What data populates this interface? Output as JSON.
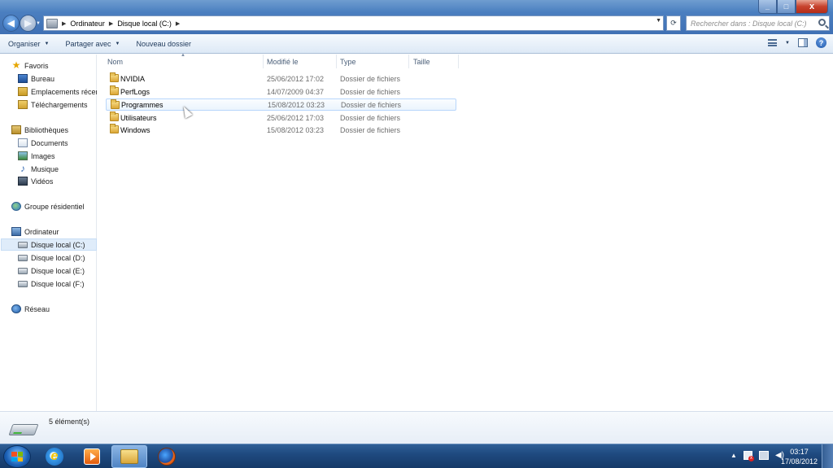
{
  "window": {
    "minimize": "_",
    "maximize": "□",
    "close": "x"
  },
  "address": {
    "crumbs": [
      "Ordinateur",
      "Disque local (C:)"
    ]
  },
  "search": {
    "placeholder": "Rechercher dans : Disque local (C:)"
  },
  "toolbar": {
    "organize": "Organiser",
    "share": "Partager avec",
    "new_folder": "Nouveau dossier",
    "help": "?"
  },
  "sidebar": {
    "favorites_header": "Favoris",
    "favorites": [
      "Bureau",
      "Emplacements récents",
      "Téléchargements"
    ],
    "libraries_header": "Bibliothèques",
    "libraries": [
      "Documents",
      "Images",
      "Musique",
      "Vidéos"
    ],
    "homegroup": "Groupe résidentiel",
    "computer_header": "Ordinateur",
    "drives": [
      "Disque local (C:)",
      "Disque local  (D:)",
      "Disque local  (E:)",
      "Disque local (F:)"
    ],
    "network": "Réseau",
    "selected": "Disque local (C:)"
  },
  "columns": {
    "name": "Nom",
    "modified": "Modifié le",
    "type": "Type",
    "size": "Taille"
  },
  "files": [
    {
      "name": "NVIDIA",
      "modified": "25/06/2012 17:02",
      "type": "Dossier de fichiers"
    },
    {
      "name": "PerfLogs",
      "modified": "14/07/2009 04:37",
      "type": "Dossier de fichiers"
    },
    {
      "name": "Programmes",
      "modified": "15/08/2012 03:23",
      "type": "Dossier de fichiers"
    },
    {
      "name": "Utilisateurs",
      "modified": "25/06/2012 17:03",
      "type": "Dossier de fichiers"
    },
    {
      "name": "Windows",
      "modified": "15/08/2012 03:23",
      "type": "Dossier de fichiers"
    }
  ],
  "hovered_file": "Programmes",
  "details": {
    "count": "5 élément(s)"
  },
  "taskbar": {
    "apps": [
      "internet-explorer-icon",
      "media-player-icon",
      "explorer-icon",
      "firefox-icon"
    ],
    "active_app": "explorer-icon",
    "time": "03:17",
    "date": "17/08/2012"
  },
  "colors": {
    "titlebar": "#4b7fc0",
    "taskbar": "#1f4a80",
    "selection": "#dfecfa",
    "hover_border": "#b8d6fb"
  }
}
